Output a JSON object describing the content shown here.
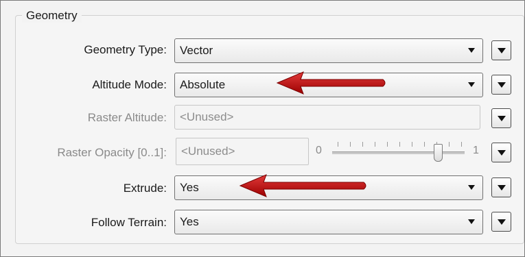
{
  "group": {
    "title": "Geometry"
  },
  "rows": {
    "geometry_type": {
      "label": "Geometry Type:",
      "value": "Vector"
    },
    "altitude_mode": {
      "label": "Altitude Mode:",
      "value": "Absolute"
    },
    "raster_altitude": {
      "label": "Raster Altitude:",
      "value": "<Unused>"
    },
    "raster_opacity": {
      "label": "Raster Opacity [0..1]:",
      "value": "<Unused>",
      "slider": {
        "min_label": "0",
        "max_label": "1",
        "level": 0.8
      }
    },
    "extrude": {
      "label": "Extrude:",
      "value": "Yes"
    },
    "follow_terrain": {
      "label": "Follow Terrain:",
      "value": "Yes"
    }
  },
  "colors": {
    "annotation_arrow": "#c00000",
    "disabled_text": "#8a8a8a"
  },
  "icons": {
    "dropdown": "dropdown-arrow-icon",
    "side_menu": "menu-arrow-icon"
  }
}
